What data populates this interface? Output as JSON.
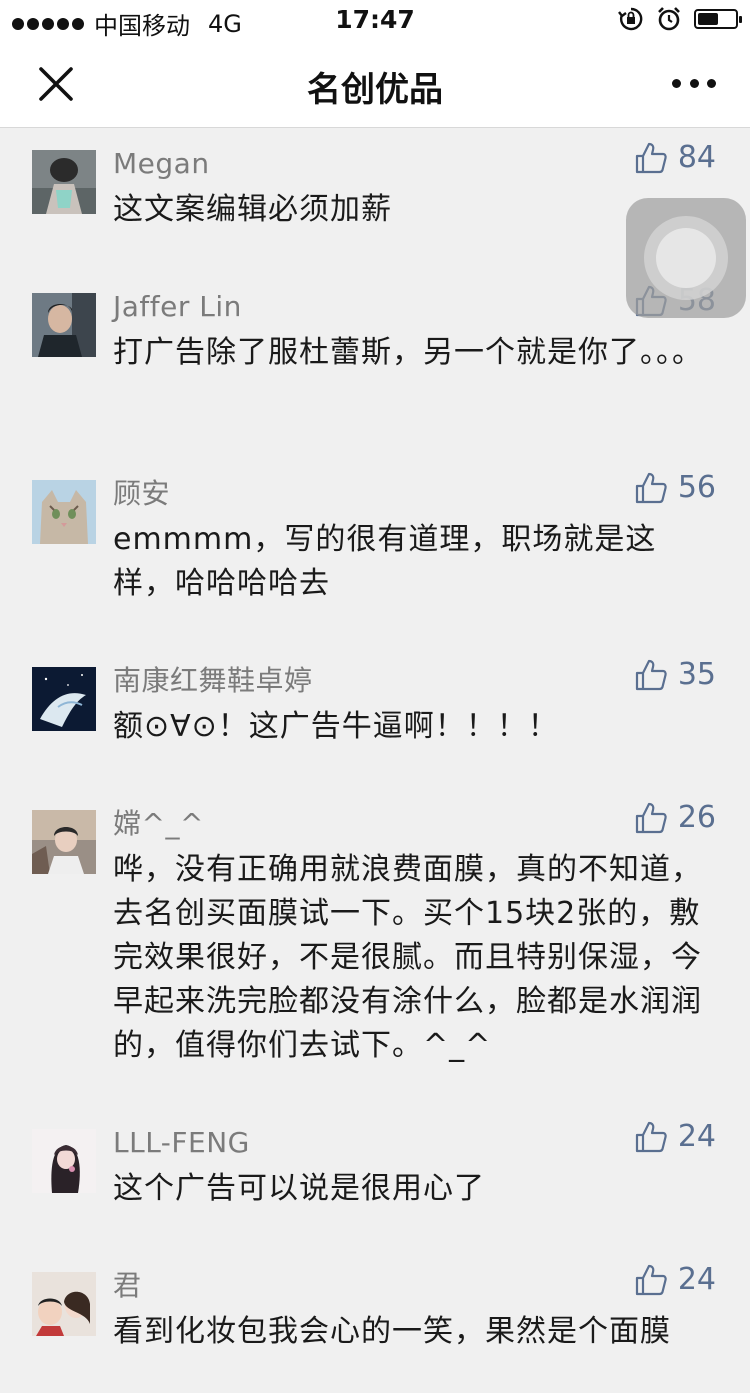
{
  "statusbar": {
    "carrier": "中国移动",
    "network": "4G",
    "time": "17:47",
    "battery_level": 0.6
  },
  "nav": {
    "title": "名创优品"
  },
  "comments": [
    {
      "nick": "Megan",
      "likes": "84",
      "text": "这文案编辑必须加薪"
    },
    {
      "nick": "Jaffer Lin",
      "likes": "58",
      "text": "打广告除了服杜蕾斯，另一个就是你了。。。"
    },
    {
      "nick": "顾安",
      "likes": "56",
      "text": "emmmm，写的很有道理，职场就是这样，哈哈哈哈去"
    },
    {
      "nick": "南康红舞鞋卓婷",
      "likes": "35",
      "text": "额⊙∀⊙！这广告牛逼啊！！！！"
    },
    {
      "nick": "嫦^_^",
      "likes": "26",
      "text": "哗，没有正确用就浪费面膜，真的不知道，去名创买面膜试一下。买个15块2张的，敷完效果很好，不是很腻。而且特别保湿，今早起来洗完脸都没有涂什么，脸都是水润润的，值得你们去试下。^_^"
    },
    {
      "nick": "LLL-FENG",
      "likes": "24",
      "text": "这个广告可以说是很用心了"
    },
    {
      "nick": "君",
      "likes": "24",
      "text": "看到化妆包我会心的一笑，果然是个面膜"
    }
  ],
  "colors": {
    "like": "#5a6f90",
    "nick": "#7b7b7b",
    "bg": "#f0f0f0"
  }
}
